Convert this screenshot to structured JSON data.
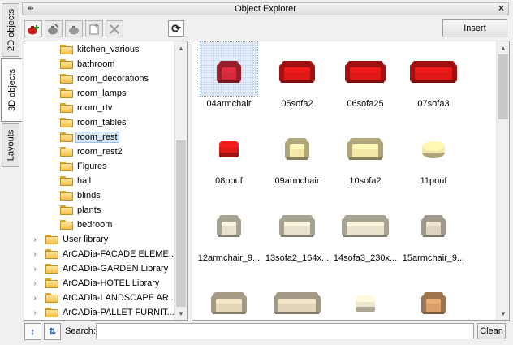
{
  "window": {
    "title": "Object Explorer"
  },
  "side_tabs": [
    {
      "label": "2D objects"
    },
    {
      "label": "3D objects"
    },
    {
      "label": "Layouts"
    }
  ],
  "toolbar": {
    "insert_label": "Insert"
  },
  "tree": {
    "items": [
      {
        "label": "kitchen_various"
      },
      {
        "label": "bathroom"
      },
      {
        "label": "room_decorations"
      },
      {
        "label": "room_lamps"
      },
      {
        "label": "room_rtv"
      },
      {
        "label": "room_tables"
      },
      {
        "label": "room_rest"
      },
      {
        "label": "room_rest2"
      },
      {
        "label": "Figures"
      },
      {
        "label": "hall"
      },
      {
        "label": "blinds"
      },
      {
        "label": "plants"
      },
      {
        "label": "bedroom"
      },
      {
        "label": "User library"
      },
      {
        "label": "ArCADia-FACADE ELEME..."
      },
      {
        "label": "ArCADia-GARDEN Library"
      },
      {
        "label": "ArCADia-HOTEL Library"
      },
      {
        "label": "ArCADia-LANDSCAPE AR..."
      },
      {
        "label": "ArCADia-PALLET FURNIT..."
      }
    ],
    "selected": "room_rest"
  },
  "objects": [
    {
      "name": "04armchair",
      "kind": "armchair",
      "color": "#d42a3c"
    },
    {
      "name": "05sofa2",
      "kind": "sofa2",
      "color": "#e01818"
    },
    {
      "name": "06sofa25",
      "kind": "sofa25",
      "color": "#e01818"
    },
    {
      "name": "07sofa3",
      "kind": "sofa3",
      "color": "#e01818"
    },
    {
      "name": "08pouf",
      "kind": "pouf",
      "color": "#e01818"
    },
    {
      "name": "09armchair",
      "kind": "armchair",
      "color": "#f3e7a8"
    },
    {
      "name": "10sofa2",
      "kind": "sofa2",
      "color": "#f3e7a8"
    },
    {
      "name": "11pouf",
      "kind": "roundpouf",
      "color": "#f3e7a8"
    },
    {
      "name": "12armchair_9...",
      "kind": "armchair",
      "color": "#e7e2cc"
    },
    {
      "name": "13sofa2_164x...",
      "kind": "sofa2",
      "color": "#e7e2cc"
    },
    {
      "name": "14sofa3_230x...",
      "kind": "sofa3",
      "color": "#e7e2cc"
    },
    {
      "name": "15armchair_9...",
      "kind": "armchair",
      "color": "#ddd4c2"
    },
    {
      "name": "",
      "kind": "sofa2",
      "color": "#e5d7b8"
    },
    {
      "name": "",
      "kind": "sofa3",
      "color": "#e2d5ba"
    },
    {
      "name": "",
      "kind": "pouf",
      "color": "#efe7cd"
    },
    {
      "name": "",
      "kind": "armchair",
      "color": "#d9a06b"
    }
  ],
  "selected_object": "04armchair",
  "bottom": {
    "search_label": "Search:",
    "search_value": "",
    "clean_label": "Clean"
  }
}
